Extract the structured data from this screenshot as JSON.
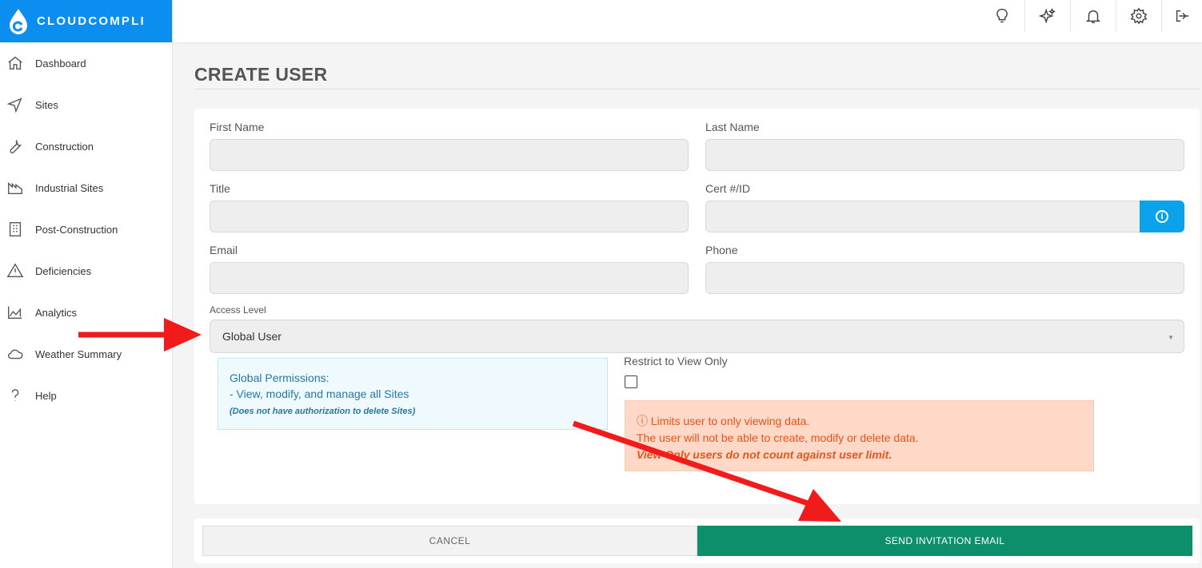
{
  "app": {
    "brand": "CLOUDCOMPLI",
    "brand_color": "#0b8ef0"
  },
  "sidebar": {
    "items": [
      {
        "label": "Dashboard",
        "icon": "home-icon"
      },
      {
        "label": "Sites",
        "icon": "navigation-icon"
      },
      {
        "label": "Construction",
        "icon": "wrench-icon"
      },
      {
        "label": "Industrial Sites",
        "icon": "factory-icon"
      },
      {
        "label": "Post-Construction",
        "icon": "building-icon"
      },
      {
        "label": "Deficiencies",
        "icon": "warning-icon"
      },
      {
        "label": "Analytics",
        "icon": "area-chart-icon"
      },
      {
        "label": "Weather Summary",
        "icon": "cloud-icon"
      },
      {
        "label": "Help",
        "icon": "question-icon"
      }
    ]
  },
  "topbar": {
    "icons": [
      "lightbulb-icon",
      "sparkles-icon",
      "bell-icon",
      "gear-icon",
      "logout-icon"
    ]
  },
  "page": {
    "title": "CREATE USER"
  },
  "form": {
    "first_name": {
      "label": "First Name",
      "value": ""
    },
    "last_name": {
      "label": "Last Name",
      "value": ""
    },
    "title": {
      "label": "Title",
      "value": ""
    },
    "cert": {
      "label": "Cert #/ID",
      "value": ""
    },
    "email": {
      "label": "Email",
      "value": ""
    },
    "phone": {
      "label": "Phone",
      "value": ""
    },
    "access_level": {
      "label": "Access Level",
      "selected": "Global User"
    },
    "permissions": {
      "heading": "Global Permissions:",
      "line": "- View, modify, and manage all Sites",
      "note": "(Does not have authorization to delete Sites)"
    },
    "view_only": {
      "label": "Restrict to View Only",
      "checked": false,
      "warn_line1": "ⓘ Limits user to only viewing data.",
      "warn_line2": "The user will not be able to create, modify or delete data.",
      "warn_line3": "View Only users do not count against user limit."
    }
  },
  "actions": {
    "cancel": "CANCEL",
    "send": "SEND INVITATION EMAIL",
    "send_color": "#0d8f6b"
  }
}
